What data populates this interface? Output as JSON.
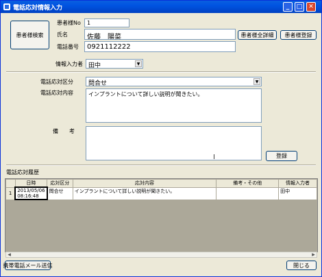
{
  "window": {
    "title": "電話応対情報入力",
    "minimize": "_",
    "maximize": "□",
    "close": "✕"
  },
  "patient": {
    "search_button": "患者様検索",
    "no_label": "患者様No",
    "no_value": "1",
    "name_label": "氏名",
    "name_value": "佐藤　陽菜",
    "phone_label": "電話番号",
    "phone_value": "0921112222",
    "detail_button": "患者様全詳細",
    "register_patient_button": "患者様登録"
  },
  "entry": {
    "entered_by_label": "情報入力者",
    "entered_by_value": "田中",
    "category_label": "電話応対区分",
    "category_value": "問合せ",
    "content_label": "電話応対内容",
    "content_value": "インプラントについて詳しい説明が聞きたい。",
    "remarks_label": "備　　考",
    "remarks_value": "",
    "register_button": "登録"
  },
  "history": {
    "label": "電話応対履歴",
    "columns": [
      "日時",
      "応対区分",
      "応対内容",
      "備考・その他",
      "情報入力者"
    ],
    "rows": [
      {
        "row_no": "1",
        "datetime_date": "2013/05/06",
        "datetime_time": "08:16:48",
        "category": "問合せ",
        "content": "インプラントについて詳しい説明が聞きたい。",
        "remarks": "",
        "entered_by": "田中"
      }
    ]
  },
  "footer": {
    "mobile_mail_button": "携帯電話メール送信",
    "close_button": "閉じる"
  },
  "icons": {
    "dropdown": "chevron-down-icon",
    "scroll_left": "arrow-left-icon",
    "scroll_right": "arrow-right-icon"
  },
  "colors": {
    "titlebar": "#0053e1",
    "window_bg": "#ece9d8",
    "field_border": "#7f9db9"
  }
}
